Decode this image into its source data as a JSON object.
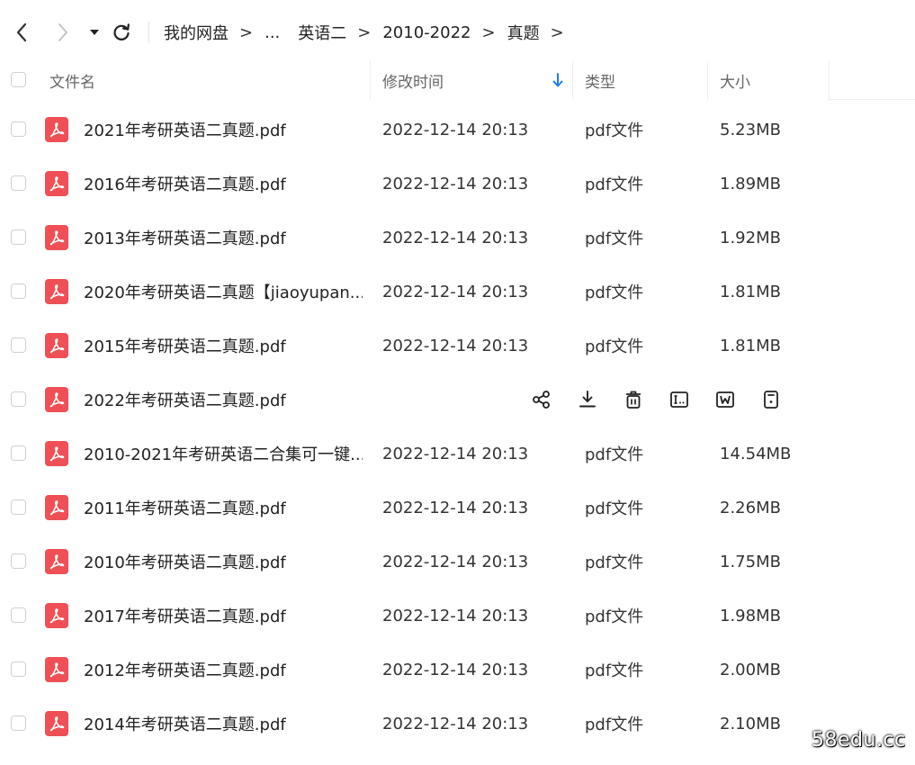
{
  "nav": {
    "back_icon": "chevron-left-icon",
    "forward_icon": "chevron-right-icon",
    "dropdown_icon": "caret-down-icon",
    "refresh_icon": "refresh-icon"
  },
  "breadcrumb": {
    "items": [
      "我的网盘",
      "...",
      "英语二",
      "2010-2022",
      "真题"
    ],
    "separator": ">"
  },
  "table": {
    "headers": {
      "name": "文件名",
      "mtime": "修改时间",
      "type": "类型",
      "size": "大小"
    },
    "sort_icon": "arrow-down-icon",
    "sort_color": "#1a7ef0",
    "rows": [
      {
        "name": "2021年考研英语二真题.pdf",
        "mtime": "2022-12-14 20:13",
        "type": "pdf文件",
        "size": "5.23MB"
      },
      {
        "name": "2016年考研英语二真题.pdf",
        "mtime": "2022-12-14 20:13",
        "type": "pdf文件",
        "size": "1.89MB"
      },
      {
        "name": "2013年考研英语二真题.pdf",
        "mtime": "2022-12-14 20:13",
        "type": "pdf文件",
        "size": "1.92MB"
      },
      {
        "name": "2020年考研英语二真题【jiaoyupan...",
        "mtime": "2022-12-14 20:13",
        "type": "pdf文件",
        "size": "1.81MB"
      },
      {
        "name": "2015年考研英语二真题.pdf",
        "mtime": "2022-12-14 20:13",
        "type": "pdf文件",
        "size": "1.81MB"
      },
      {
        "name": "2022年考研英语二真题.pdf",
        "hovered": true
      },
      {
        "name": "2010-2021年考研英语二合集可一键...",
        "mtime": "2022-12-14 20:13",
        "type": "pdf文件",
        "size": "14.54MB"
      },
      {
        "name": "2011年考研英语二真题.pdf",
        "mtime": "2022-12-14 20:13",
        "type": "pdf文件",
        "size": "2.26MB"
      },
      {
        "name": "2010年考研英语二真题.pdf",
        "mtime": "2022-12-14 20:13",
        "type": "pdf文件",
        "size": "1.75MB"
      },
      {
        "name": "2017年考研英语二真题.pdf",
        "mtime": "2022-12-14 20:13",
        "type": "pdf文件",
        "size": "1.98MB"
      },
      {
        "name": "2012年考研英语二真题.pdf",
        "mtime": "2022-12-14 20:13",
        "type": "pdf文件",
        "size": "2.00MB"
      },
      {
        "name": "2014年考研英语二真题.pdf",
        "mtime": "2022-12-14 20:13",
        "type": "pdf文件",
        "size": "2.10MB"
      }
    ],
    "file_icon": "pdf-file-icon",
    "file_icon_color": "#ef4f55",
    "hover_actions": [
      "share-icon",
      "download-icon",
      "delete-icon",
      "rename-icon",
      "save-to-icon",
      "more-icon"
    ]
  },
  "watermark": "58edu.cc"
}
